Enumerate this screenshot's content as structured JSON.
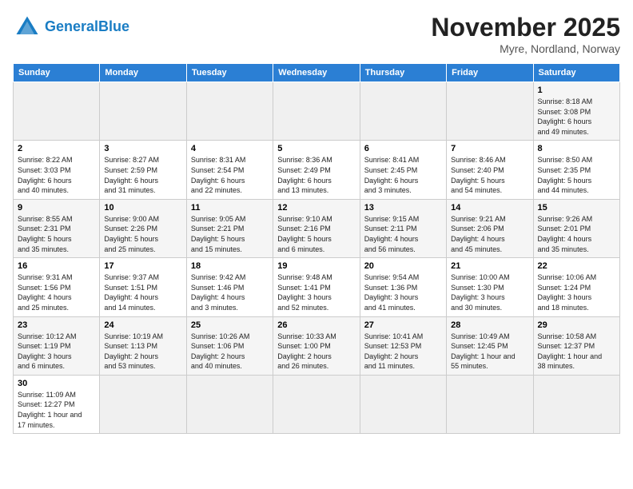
{
  "header": {
    "logo_general": "General",
    "logo_blue": "Blue",
    "month_title": "November 2025",
    "location": "Myre, Nordland, Norway"
  },
  "weekdays": [
    "Sunday",
    "Monday",
    "Tuesday",
    "Wednesday",
    "Thursday",
    "Friday",
    "Saturday"
  ],
  "weeks": [
    [
      {
        "day": "",
        "info": ""
      },
      {
        "day": "",
        "info": ""
      },
      {
        "day": "",
        "info": ""
      },
      {
        "day": "",
        "info": ""
      },
      {
        "day": "",
        "info": ""
      },
      {
        "day": "",
        "info": ""
      },
      {
        "day": "1",
        "info": "Sunrise: 8:18 AM\nSunset: 3:08 PM\nDaylight: 6 hours\nand 49 minutes."
      }
    ],
    [
      {
        "day": "2",
        "info": "Sunrise: 8:22 AM\nSunset: 3:03 PM\nDaylight: 6 hours\nand 40 minutes."
      },
      {
        "day": "3",
        "info": "Sunrise: 8:27 AM\nSunset: 2:59 PM\nDaylight: 6 hours\nand 31 minutes."
      },
      {
        "day": "4",
        "info": "Sunrise: 8:31 AM\nSunset: 2:54 PM\nDaylight: 6 hours\nand 22 minutes."
      },
      {
        "day": "5",
        "info": "Sunrise: 8:36 AM\nSunset: 2:49 PM\nDaylight: 6 hours\nand 13 minutes."
      },
      {
        "day": "6",
        "info": "Sunrise: 8:41 AM\nSunset: 2:45 PM\nDaylight: 6 hours\nand 3 minutes."
      },
      {
        "day": "7",
        "info": "Sunrise: 8:46 AM\nSunset: 2:40 PM\nDaylight: 5 hours\nand 54 minutes."
      },
      {
        "day": "8",
        "info": "Sunrise: 8:50 AM\nSunset: 2:35 PM\nDaylight: 5 hours\nand 44 minutes."
      }
    ],
    [
      {
        "day": "9",
        "info": "Sunrise: 8:55 AM\nSunset: 2:31 PM\nDaylight: 5 hours\nand 35 minutes."
      },
      {
        "day": "10",
        "info": "Sunrise: 9:00 AM\nSunset: 2:26 PM\nDaylight: 5 hours\nand 25 minutes."
      },
      {
        "day": "11",
        "info": "Sunrise: 9:05 AM\nSunset: 2:21 PM\nDaylight: 5 hours\nand 15 minutes."
      },
      {
        "day": "12",
        "info": "Sunrise: 9:10 AM\nSunset: 2:16 PM\nDaylight: 5 hours\nand 6 minutes."
      },
      {
        "day": "13",
        "info": "Sunrise: 9:15 AM\nSunset: 2:11 PM\nDaylight: 4 hours\nand 56 minutes."
      },
      {
        "day": "14",
        "info": "Sunrise: 9:21 AM\nSunset: 2:06 PM\nDaylight: 4 hours\nand 45 minutes."
      },
      {
        "day": "15",
        "info": "Sunrise: 9:26 AM\nSunset: 2:01 PM\nDaylight: 4 hours\nand 35 minutes."
      }
    ],
    [
      {
        "day": "16",
        "info": "Sunrise: 9:31 AM\nSunset: 1:56 PM\nDaylight: 4 hours\nand 25 minutes."
      },
      {
        "day": "17",
        "info": "Sunrise: 9:37 AM\nSunset: 1:51 PM\nDaylight: 4 hours\nand 14 minutes."
      },
      {
        "day": "18",
        "info": "Sunrise: 9:42 AM\nSunset: 1:46 PM\nDaylight: 4 hours\nand 3 minutes."
      },
      {
        "day": "19",
        "info": "Sunrise: 9:48 AM\nSunset: 1:41 PM\nDaylight: 3 hours\nand 52 minutes."
      },
      {
        "day": "20",
        "info": "Sunrise: 9:54 AM\nSunset: 1:36 PM\nDaylight: 3 hours\nand 41 minutes."
      },
      {
        "day": "21",
        "info": "Sunrise: 10:00 AM\nSunset: 1:30 PM\nDaylight: 3 hours\nand 30 minutes."
      },
      {
        "day": "22",
        "info": "Sunrise: 10:06 AM\nSunset: 1:24 PM\nDaylight: 3 hours\nand 18 minutes."
      }
    ],
    [
      {
        "day": "23",
        "info": "Sunrise: 10:12 AM\nSunset: 1:19 PM\nDaylight: 3 hours\nand 6 minutes."
      },
      {
        "day": "24",
        "info": "Sunrise: 10:19 AM\nSunset: 1:13 PM\nDaylight: 2 hours\nand 53 minutes."
      },
      {
        "day": "25",
        "info": "Sunrise: 10:26 AM\nSunset: 1:06 PM\nDaylight: 2 hours\nand 40 minutes."
      },
      {
        "day": "26",
        "info": "Sunrise: 10:33 AM\nSunset: 1:00 PM\nDaylight: 2 hours\nand 26 minutes."
      },
      {
        "day": "27",
        "info": "Sunrise: 10:41 AM\nSunset: 12:53 PM\nDaylight: 2 hours\nand 11 minutes."
      },
      {
        "day": "28",
        "info": "Sunrise: 10:49 AM\nSunset: 12:45 PM\nDaylight: 1 hour and\n55 minutes."
      },
      {
        "day": "29",
        "info": "Sunrise: 10:58 AM\nSunset: 12:37 PM\nDaylight: 1 hour and\n38 minutes."
      }
    ],
    [
      {
        "day": "30",
        "info": "Sunrise: 11:09 AM\nSunset: 12:27 PM\nDaylight: 1 hour and\n17 minutes."
      },
      {
        "day": "",
        "info": ""
      },
      {
        "day": "",
        "info": ""
      },
      {
        "day": "",
        "info": ""
      },
      {
        "day": "",
        "info": ""
      },
      {
        "day": "",
        "info": ""
      },
      {
        "day": "",
        "info": ""
      }
    ]
  ]
}
